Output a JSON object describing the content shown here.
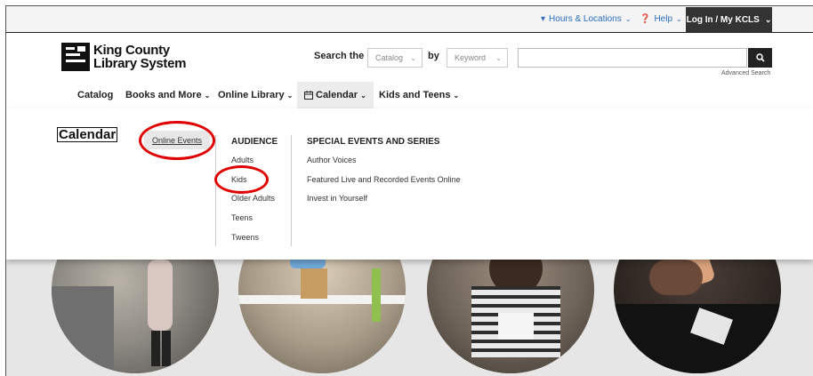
{
  "utility": {
    "hours_label": "Hours & Locations",
    "help_label": "Help",
    "login_label": "Log In / My KCLS"
  },
  "logo": {
    "line1": "King County",
    "line2": "Library System"
  },
  "search": {
    "label": "Search the",
    "scope_value": "Catalog",
    "by_label": "by",
    "field_value": "Keyword",
    "query": "",
    "advanced_label": "Advanced Search"
  },
  "nav": {
    "items": [
      {
        "label": "Catalog"
      },
      {
        "label": "Books and More"
      },
      {
        "label": "Online Library"
      },
      {
        "label": "Calendar"
      },
      {
        "label": "Kids and Teens"
      }
    ]
  },
  "mega_menu": {
    "title": "Calendar",
    "online_events_label": "Online Events",
    "audience": {
      "heading": "AUDIENCE",
      "items": [
        "Adults",
        "Kids",
        "Older Adults",
        "Teens",
        "Tweens"
      ]
    },
    "special": {
      "heading": "SPECIAL EVENTS AND SERIES",
      "items": [
        "Author Voices",
        "Featured Live and Recorded Events Online",
        "Invest in Yourself"
      ]
    }
  },
  "colors": {
    "utility_bg": "#f4f4f4",
    "login_bg": "#333333",
    "link_blue": "#2a6ebb",
    "highlight_ring": "#e00000"
  }
}
